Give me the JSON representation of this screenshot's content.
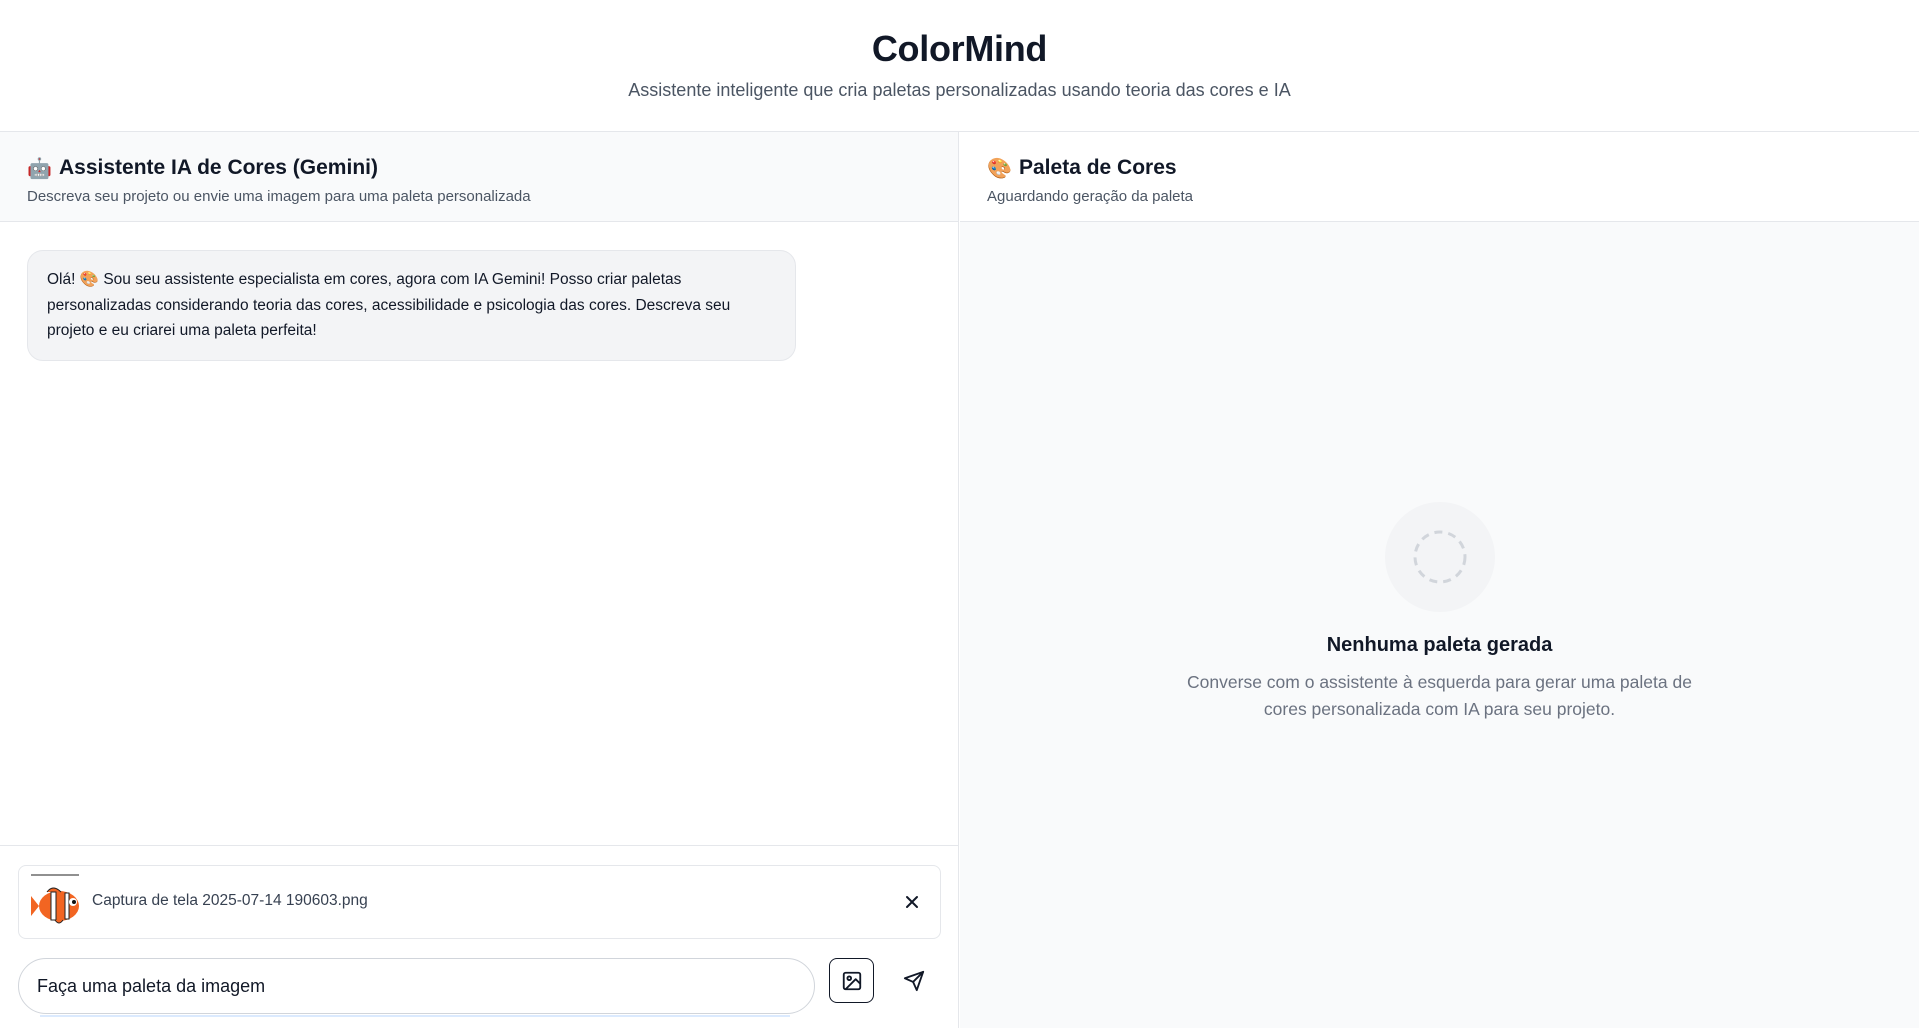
{
  "header": {
    "title": "ColorMind",
    "subtitle": "Assistente inteligente que cria paletas personalizadas usando teoria das cores e IA"
  },
  "chat_panel": {
    "emoji": "🤖",
    "title": "Assistente IA de Cores (Gemini)",
    "description": "Descreva seu projeto ou envie uma imagem para uma paleta personalizada",
    "messages": [
      {
        "role": "assistant",
        "text": "Olá! 🎨 Sou seu assistente especialista em cores, agora com IA Gemini! Posso criar paletas personalizadas considerando teoria das cores, acessibilidade e psicologia das cores. Descreva seu projeto e eu criarei uma paleta perfeita!"
      }
    ]
  },
  "attachment": {
    "filename": "Captura de tela 2025-07-14 190603.png",
    "thumbnail_icon": "clownfish-image"
  },
  "input": {
    "value": "Faça uma paleta da imagem"
  },
  "palette_panel": {
    "emoji": "🎨",
    "title": "Paleta de Cores",
    "description": "Aguardando geração da paleta",
    "empty_title": "Nenhuma paleta gerada",
    "empty_description": "Converse com o assistente à esquerda para gerar uma paleta de cores personalizada com IA para seu projeto."
  },
  "colors": {
    "text_primary": "#111827",
    "text_secondary": "#4b5563",
    "border": "#e5e7eb",
    "panel_bg": "#f9fafb",
    "bubble_bg": "#f3f4f6"
  }
}
